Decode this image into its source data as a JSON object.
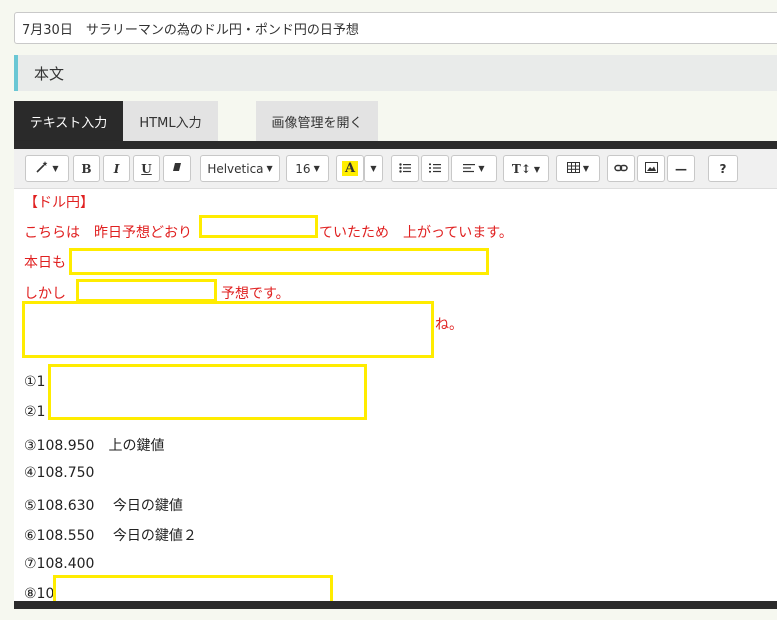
{
  "post_title": "7月30日　サラリーマンの為のドル円・ポンド円の日予想",
  "section_label": "本文",
  "tabs": {
    "text_input": "テキスト入力",
    "html_input": "HTML入力",
    "image_manager": "画像管理を開く"
  },
  "toolbar": {
    "magic_icon": "magic-wand-icon",
    "bold": "B",
    "italic": "I",
    "underline": "U",
    "eraser_icon": "eraser-icon",
    "font_family": "Helvetica",
    "font_size": "16",
    "font_color": "A",
    "list_unordered_icon": "bullet-list-icon",
    "list_ordered_icon": "numbered-list-icon",
    "align_icon": "align-left-icon",
    "text_size_label": "T↕",
    "table_icon": "table-icon",
    "link_icon": "link-icon",
    "picture_icon": "picture-icon",
    "hr_label": "—",
    "help": "?"
  },
  "content": {
    "heading": "【ドル円】",
    "line1_prefix": "こちらは　昨日予想どおり",
    "line1_suffix": "ていたため　上がっています。",
    "line2_prefix": "本日も",
    "line3_prefix": "しかし",
    "line3_suffix": "予想です。",
    "line4_suffix": "ね。",
    "item1": "①1",
    "item2": "②1",
    "item3": "③108.950　上の鍵値",
    "item4": "④108.750",
    "item5": "⑤108.630　 今日の鍵値",
    "item6": "⑥108.550　 今日の鍵値２",
    "item7": "⑦108.400",
    "item8": "⑧10"
  },
  "colors": {
    "red_text": "#e02020",
    "redaction_border": "#ffec00",
    "active_tab": "#2a2a2a",
    "header_accent": "#6ac7d4"
  }
}
